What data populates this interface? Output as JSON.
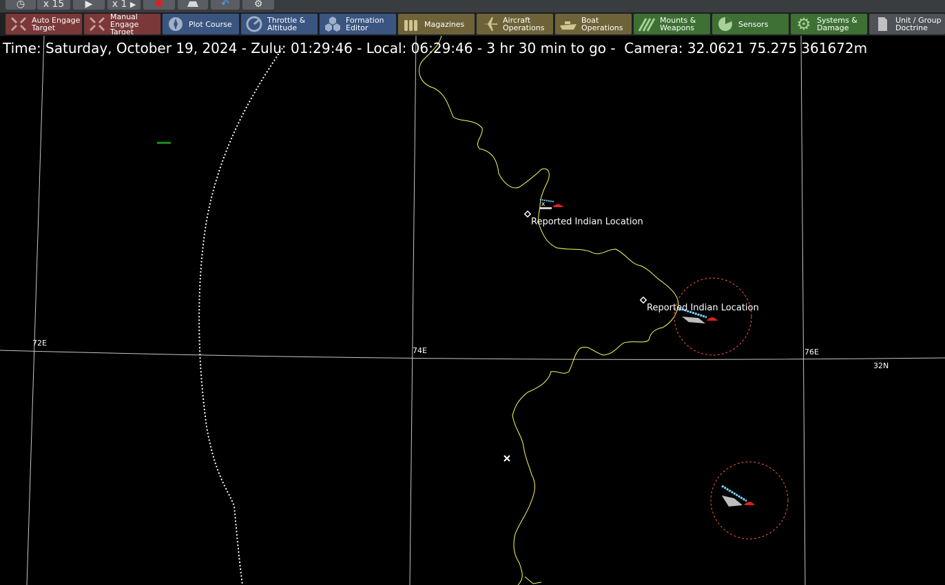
{
  "top_controls": {
    "speed_label": "x 15",
    "step_label": "x 1",
    "icons": [
      "clock-icon",
      "play-icon",
      "step-icon",
      "record-icon",
      "unit-icon",
      "undo-icon",
      "settings-icon"
    ]
  },
  "toolbar": [
    {
      "id": "auto-engage",
      "label": "Auto Engage\nTarget",
      "icon": "target-icon",
      "color": "#7a3838"
    },
    {
      "id": "manual-engage",
      "label": "Manual\nEngage Target",
      "icon": "target-icon",
      "color": "#7a3838"
    },
    {
      "id": "plot-course",
      "label": "Plot Course",
      "icon": "compass-icon",
      "color": "#3a5580"
    },
    {
      "id": "throttle",
      "label": "Throttle &\nAltitude",
      "icon": "gauge-icon",
      "color": "#3a5580"
    },
    {
      "id": "formation",
      "label": "Formation\nEditor",
      "icon": "hexagons-icon",
      "color": "#3a5580"
    },
    {
      "id": "magazines",
      "label": "Magazines",
      "icon": "ammo-icon",
      "color": "#6e6338"
    },
    {
      "id": "aircraft-ops",
      "label": "Aircraft\nOperations",
      "icon": "aircraft-icon",
      "color": "#6e6338"
    },
    {
      "id": "boat-ops",
      "label": "Boat\nOperations",
      "icon": "boat-icon",
      "color": "#6e6338"
    },
    {
      "id": "mounts",
      "label": "Mounts &\nWeapons",
      "icon": "missiles-icon",
      "color": "#3e7034"
    },
    {
      "id": "sensors",
      "label": "Sensors",
      "icon": "radar-icon",
      "color": "#3e7034"
    },
    {
      "id": "systems",
      "label": "Systems &\nDamage",
      "icon": "gear-icon",
      "color": "#3e7034"
    },
    {
      "id": "doctrine",
      "label": "Unit / Group\nDoctrine",
      "icon": "document-icon",
      "color": "#4e5155"
    }
  ],
  "status_line": "Time: Saturday, October 19, 2024 - Zulu: 01:29:46 - Local: 06:29:46 - 3 hr 30 min to go -  Camera: 32.0621 75.275 361672m",
  "map": {
    "grid_labels": {
      "lon72": "72E",
      "lon74": "74E",
      "lon76": "76E",
      "lat32": "32N"
    },
    "markers": [
      {
        "label": "Reported Indian Location"
      },
      {
        "label": "Reported Indian Location"
      }
    ],
    "colors": {
      "border": "#ffff66",
      "grid": "#c8c8c8",
      "range_ring": "#ff5a3c",
      "friendly": "#7fd4ff",
      "hostile": "#e02020",
      "datum": "#ffffff",
      "marker_green": "#1a8a1a"
    }
  }
}
